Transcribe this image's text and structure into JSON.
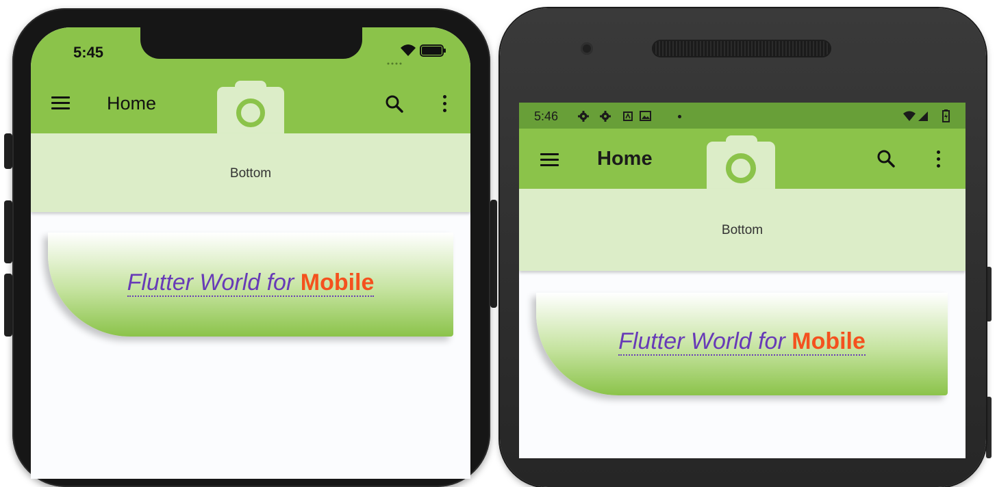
{
  "ios": {
    "status_time": "5:45",
    "app_title": "Home",
    "bottom_label": "Bottom",
    "banner": {
      "prefix": "Flutter World for",
      "accent": "Mobile"
    }
  },
  "android": {
    "status_time": "5:46",
    "app_title": "Home",
    "bottom_label": "Bottom",
    "banner": {
      "prefix": "Flutter World for",
      "accent": "Mobile"
    }
  },
  "icons": {
    "menu": "menu-icon",
    "search": "search-icon",
    "more": "more-vert-icon",
    "camera": "camera-icon"
  },
  "colors": {
    "appbar": "#8bc34a",
    "android_statusbar": "#689f38",
    "bottom_area": "#dcedc8",
    "banner_text": "#673ab7",
    "banner_accent": "#f4511e"
  }
}
